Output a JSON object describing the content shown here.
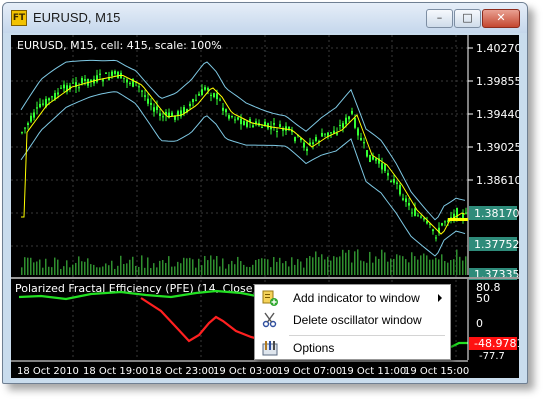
{
  "window": {
    "title": "EURUSD, M15",
    "app_icon_text": "FT",
    "buttons": {
      "minimize": "–",
      "maximize": "□",
      "close": "✕"
    }
  },
  "main_chart": {
    "info": "EURUSD, M15, cell: 415, scale: 100%",
    "price_labels": [
      "1.40270",
      "1.39855",
      "1.39440",
      "1.39025",
      "1.38610",
      "1.38170",
      "1.37752",
      "1.37335"
    ],
    "current_price_highlight": "1.38170",
    "colors": {
      "background": "#000000",
      "candles": "#33ff33",
      "ma": "#ffff00",
      "bands": "#7ec8e3",
      "highlight": "#2e8b7a",
      "grid": "#3a3a3a"
    }
  },
  "oscillator": {
    "label": "Polarized Fractal Efficiency (PFE) (14, Close)",
    "scale_labels": [
      "80.8",
      "50",
      "0",
      "-48.9781",
      "-77.7"
    ],
    "value_label": "-48.9781",
    "colors": {
      "positive": "#22e022",
      "negative": "#ff2020",
      "value_bg": "#ff1010"
    }
  },
  "time_axis": [
    "18 Oct 2010",
    "18 Oct 19:00",
    "18 Oct 23:00",
    "19 Oct 03:00",
    "19 Oct 07:00",
    "19 Oct 11:00",
    "19 Oct 15:00"
  ],
  "context_menu": {
    "items": [
      {
        "label": "Add indicator to window",
        "icon": "add-indicator-icon",
        "submenu": true
      },
      {
        "label": "Delete oscillator window",
        "icon": "scissors-icon",
        "submenu": false
      },
      {
        "label": "Options",
        "icon": "options-icon",
        "submenu": false
      }
    ]
  }
}
